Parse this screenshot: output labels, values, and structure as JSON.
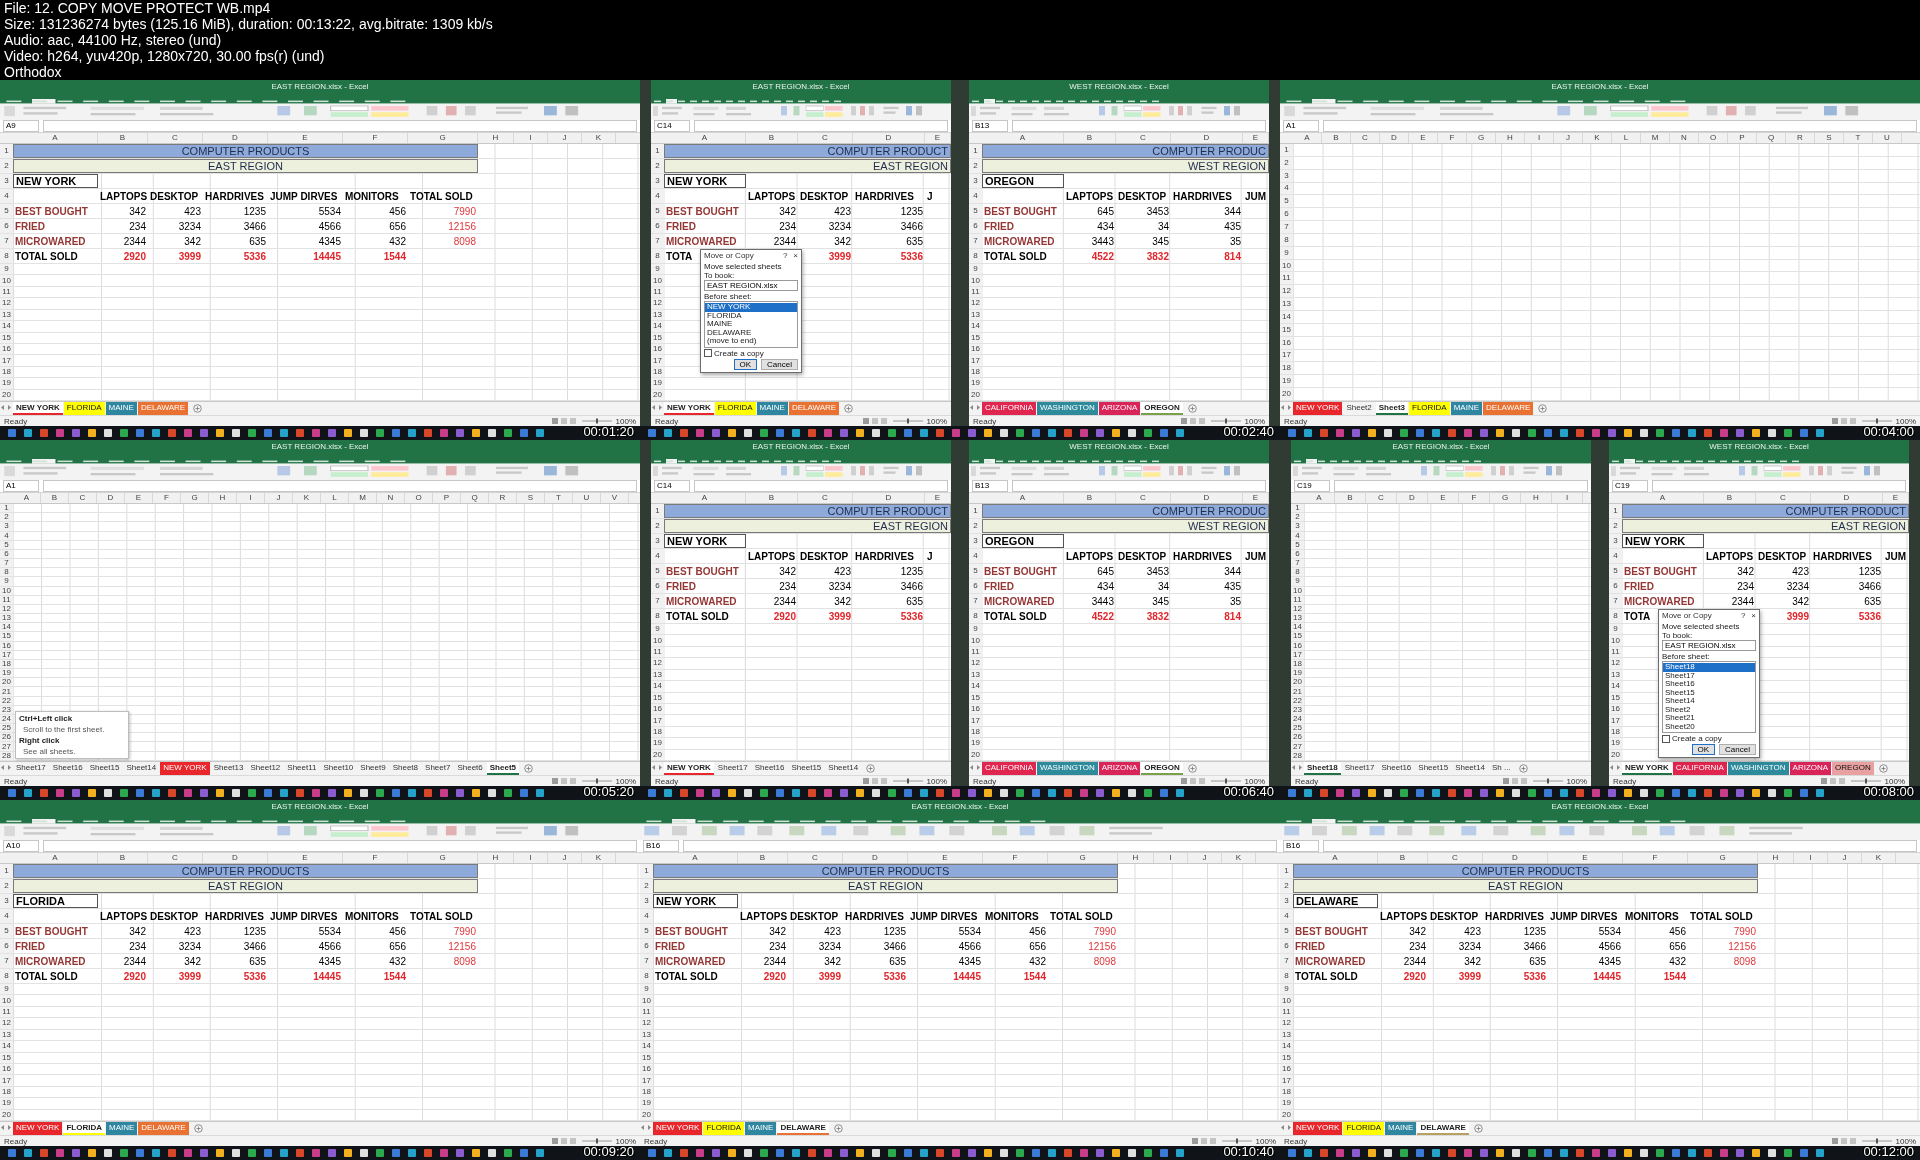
{
  "header": [
    "File: 12. COPY MOVE PROTECT WB.mp4",
    "Size: 131236274 bytes (125.16 MiB), duration: 00:13:22, avg.bitrate: 1309 kb/s",
    "Audio: aac, 44100 Hz, stereo (und)",
    "Video: h264, yuv420p, 1280x720, 30.00 fps(r) (und)",
    "Orthodox"
  ],
  "frames": [
    {
      "time": "00:01:20",
      "windows": [
        {
          "title": "EAST REGION.xlsx - Excel",
          "ribbon": {
            "kind": "home"
          },
          "name_box": "A9",
          "kind": "table",
          "columns": [
            "A",
            "B",
            "C",
            "D",
            "E",
            "F",
            "G",
            "H",
            "I",
            "J",
            "K"
          ],
          "rows": [
            {
              "n": "1",
              "kind": "title",
              "cells": [
                "COMPUTER PRODUCTS"
              ]
            },
            {
              "n": "2",
              "kind": "region",
              "cells": [
                "EAST REGION"
              ]
            },
            {
              "n": "3",
              "kind": "location",
              "cells": [
                "NEW YORK"
              ]
            },
            {
              "n": "4",
              "kind": "header",
              "cells": [
                "",
                "LAPTOPS",
                "DESKTOP",
                "HARDRIVES",
                "JUMP DIRVES",
                "MONITORS",
                "TOTAL SOLD"
              ]
            },
            {
              "n": "5",
              "kind": "data",
              "cells": [
                "BEST BOUGHT",
                "342",
                "423",
                "1235",
                "5534",
                "456",
                "7990"
              ]
            },
            {
              "n": "6",
              "kind": "data",
              "cells": [
                "FRIED",
                "234",
                "3234",
                "3466",
                "4566",
                "656",
                "12156"
              ]
            },
            {
              "n": "7",
              "kind": "data",
              "cells": [
                "MICROWARED",
                "2344",
                "342",
                "635",
                "4345",
                "432",
                "8098"
              ]
            },
            {
              "n": "8",
              "kind": "total",
              "cells": [
                "TOTAL SOLD",
                "2920",
                "3999",
                "5336",
                "14445",
                "1544"
              ]
            }
          ],
          "blank_rows": [
            "9",
            "10",
            "11",
            "12",
            "13",
            "14",
            "15",
            "16",
            "17",
            "18",
            "19",
            "20"
          ],
          "tabs": [
            {
              "label": "NEW YORK",
              "color": "#e8262b",
              "selected": true
            },
            {
              "label": "FLORIDA",
              "color": "#ffff00",
              "selected": false
            },
            {
              "label": "MAINE",
              "color": "#2e86a0",
              "selected": false
            },
            {
              "label": "DELAWARE",
              "color": "#e97132",
              "selected": false
            }
          ],
          "status": "Ready",
          "zoom": "100%"
        }
      ]
    },
    {
      "time": "00:02:40",
      "windows": [
        {
          "title": "EAST REGION.xlsx - Excel",
          "ribbon": {
            "kind": "home"
          },
          "name_box": "C14",
          "kind": "table",
          "columns": [
            "A",
            "B",
            "C",
            "D",
            "E"
          ],
          "rows": [
            {
              "n": "1",
              "kind": "title",
              "cells": [
                "COMPUTER PRODUCT"
              ]
            },
            {
              "n": "2",
              "kind": "region",
              "cells": [
                "EAST REGION"
              ]
            },
            {
              "n": "3",
              "kind": "location",
              "cells": [
                "NEW YORK"
              ]
            },
            {
              "n": "4",
              "kind": "header",
              "cells": [
                "",
                "LAPTOPS",
                "DESKTOP",
                "HARDRIVES",
                "J"
              ]
            },
            {
              "n": "5",
              "kind": "data",
              "cells": [
                "BEST BOUGHT",
                "342",
                "423",
                "1235"
              ]
            },
            {
              "n": "6",
              "kind": "data",
              "cells": [
                "FRIED",
                "234",
                "3234",
                "3466"
              ]
            },
            {
              "n": "7",
              "kind": "data",
              "cells": [
                "MICROWARED",
                "2344",
                "342",
                "635"
              ]
            },
            {
              "n": "8",
              "kind": "total",
              "cells": [
                "TOTA",
                null,
                "3999",
                "5336"
              ]
            }
          ],
          "blank_rows": [
            "9",
            "10",
            "11",
            "12",
            "13",
            "14",
            "15",
            "16",
            "17",
            "18",
            "19",
            "20"
          ],
          "tabs": [
            {
              "label": "NEW YORK",
              "color": "#e8262b",
              "selected": true
            },
            {
              "label": "FLORIDA",
              "color": "#ffff00",
              "selected": false
            },
            {
              "label": "MAINE",
              "color": "#2e86a0",
              "selected": false
            },
            {
              "label": "DELAWARE",
              "color": "#e97132",
              "selected": false
            }
          ],
          "status": "Ready",
          "zoom": "100%",
          "dialog": {
            "title": "Move or Copy",
            "help": "?",
            "close": "×",
            "caption": "Move selected sheets",
            "to_book_label": "To book:",
            "to_book": "EAST REGION.xlsx",
            "before_label": "Before sheet:",
            "items": [
              {
                "label": "NEW YORK",
                "selected": true
              },
              {
                "label": "FLORIDA",
                "selected": false
              },
              {
                "label": "MAINE",
                "selected": false
              },
              {
                "label": "DELAWARE",
                "selected": false
              },
              {
                "label": "(move to end)",
                "selected": false
              }
            ],
            "copy_label": "Create a copy",
            "copy_checked": false,
            "ok": "OK",
            "cancel": "Cancel"
          }
        },
        {
          "title": "WEST REGION.xlsx - Excel",
          "ribbon": {
            "kind": "home"
          },
          "name_box": "B13",
          "kind": "table",
          "columns": [
            "A",
            "B",
            "C",
            "D",
            "E"
          ],
          "rows": [
            {
              "n": "1",
              "kind": "title",
              "cells": [
                "COMPUTER PRODUC"
              ]
            },
            {
              "n": "2",
              "kind": "region",
              "cells": [
                "WEST REGION"
              ]
            },
            {
              "n": "3",
              "kind": "location",
              "cells": [
                "OREGON"
              ]
            },
            {
              "n": "4",
              "kind": "header",
              "cells": [
                "",
                "LAPTOPS",
                "DESKTOP",
                "HARDRIVES",
                "JUM"
              ]
            },
            {
              "n": "5",
              "kind": "data",
              "cells": [
                "BEST BOUGHT",
                "645",
                "3453",
                "344"
              ]
            },
            {
              "n": "6",
              "kind": "data",
              "cells": [
                "FRIED",
                "434",
                "34",
                "435"
              ]
            },
            {
              "n": "7",
              "kind": "data",
              "cells": [
                "MICROWARED",
                "3443",
                "345",
                "35"
              ]
            },
            {
              "n": "8",
              "kind": "total",
              "cells": [
                "TOTAL SOLD",
                "4522",
                "3832",
                "814"
              ]
            }
          ],
          "blank_rows": [
            "9",
            "10",
            "11",
            "12",
            "13",
            "14",
            "15",
            "16",
            "17",
            "18",
            "19",
            "20"
          ],
          "tabs": [
            {
              "label": "CALIFORNIA",
              "color": "#e0264f",
              "selected": false
            },
            {
              "label": "WASHINGTON",
              "color": "#2e8b9c",
              "selected": false
            },
            {
              "label": "ARIZONA",
              "color": "#d9245a",
              "selected": false
            },
            {
              "label": "OREGON",
              "color": "#7aa04a",
              "selected": true
            }
          ],
          "status": "Ready",
          "zoom": "100%"
        }
      ]
    },
    {
      "time": "00:04:00",
      "windows": [
        {
          "title": "EAST REGION.xlsx - Excel",
          "ribbon": {
            "kind": "home"
          },
          "name_box": "A1",
          "kind": "blank",
          "columns": [
            "A",
            "B",
            "C",
            "D",
            "E",
            "F",
            "G",
            "H",
            "I",
            "J",
            "K",
            "L",
            "M",
            "N",
            "O",
            "P",
            "Q",
            "R",
            "S",
            "T",
            "U"
          ],
          "blank_rows": [
            "1",
            "2",
            "3",
            "4",
            "5",
            "6",
            "7",
            "8",
            "9",
            "10",
            "11",
            "12",
            "13",
            "14",
            "15",
            "16",
            "17",
            "18",
            "19",
            "20"
          ],
          "tabs": [
            {
              "label": "NEW YORK",
              "color": "#e8262b",
              "selected": false
            },
            {
              "label": "Sheet2",
              "selected": false
            },
            {
              "label": "Sheet3",
              "selected": true
            },
            {
              "label": "FLORIDA",
              "color": "#ffff00",
              "selected": false
            },
            {
              "label": "MAINE",
              "color": "#2e86a0",
              "selected": false
            },
            {
              "label": "DELAWARE",
              "color": "#e97132",
              "selected": false
            }
          ],
          "status": "Ready",
          "zoom": "100%"
        }
      ]
    },
    {
      "time": "00:05:20",
      "windows": [
        {
          "title": "EAST REGION.xlsx - Excel",
          "ribbon": {
            "kind": "home"
          },
          "name_box": "A1",
          "kind": "blank",
          "columns": [
            "A",
            "B",
            "C",
            "D",
            "E",
            "F",
            "G",
            "H",
            "I",
            "J",
            "K",
            "L",
            "M",
            "N",
            "O",
            "P",
            "Q",
            "R",
            "S",
            "T",
            "U",
            "V"
          ],
          "blank_rows": [
            "1",
            "2",
            "3",
            "4",
            "5",
            "6",
            "7",
            "8",
            "9",
            "10",
            "11",
            "12",
            "13",
            "14",
            "15",
            "16",
            "17",
            "18",
            "19",
            "20",
            "21",
            "22",
            "23",
            "24",
            "25",
            "26",
            "27",
            "28"
          ],
          "tabs": [
            {
              "label": "Sheet17",
              "selected": false
            },
            {
              "label": "Sheet16",
              "selected": false
            },
            {
              "label": "Sheet15",
              "selected": false
            },
            {
              "label": "Sheet14",
              "selected": false
            },
            {
              "label": "NEW YORK",
              "color": "#e8262b",
              "selected": false
            },
            {
              "label": "Sheet13",
              "selected": false
            },
            {
              "label": "Sheet12",
              "selected": false
            },
            {
              "label": "Sheet11",
              "selected": false
            },
            {
              "label": "Sheet10",
              "selected": false
            },
            {
              "label": "Sheet9",
              "selected": false
            },
            {
              "label": "Sheet8",
              "selected": false
            },
            {
              "label": "Sheet7",
              "selected": false
            },
            {
              "label": "Sheet6",
              "selected": false
            },
            {
              "label": "Sheet5",
              "selected": true
            }
          ],
          "status": "Ready",
          "zoom": "100%",
          "tooltip": [
            {
              "kind": "heading",
              "text": "Ctrl+Left click"
            },
            {
              "kind": "body",
              "text": "Scroll to the first sheet."
            },
            {
              "kind": "heading",
              "text": "Right click"
            },
            {
              "kind": "body",
              "text": "See all sheets."
            }
          ]
        }
      ]
    },
    {
      "time": "00:06:40",
      "windows": [
        {
          "title": "EAST REGION.xlsx - Excel",
          "ribbon": {
            "kind": "home"
          },
          "name_box": "C14",
          "kind": "table",
          "columns": [
            "A",
            "B",
            "C",
            "D",
            "E"
          ],
          "rows": [
            {
              "n": "1",
              "kind": "title",
              "cells": [
                "COMPUTER PRODUCT"
              ]
            },
            {
              "n": "2",
              "kind": "region",
              "cells": [
                "EAST REGION"
              ]
            },
            {
              "n": "3",
              "kind": "location",
              "cells": [
                "NEW YORK"
              ]
            },
            {
              "n": "4",
              "kind": "header",
              "cells": [
                "",
                "LAPTOPS",
                "DESKTOP",
                "HARDRIVES",
                "J"
              ]
            },
            {
              "n": "5",
              "kind": "data",
              "cells": [
                "BEST BOUGHT",
                "342",
                "423",
                "1235"
              ]
            },
            {
              "n": "6",
              "kind": "data",
              "cells": [
                "FRIED",
                "234",
                "3234",
                "3466"
              ]
            },
            {
              "n": "7",
              "kind": "data",
              "cells": [
                "MICROWARED",
                "2344",
                "342",
                "635"
              ]
            },
            {
              "n": "8",
              "kind": "total",
              "cells": [
                "TOTAL SOLD",
                "2920",
                "3999",
                "5336"
              ]
            }
          ],
          "blank_rows": [
            "9",
            "10",
            "11",
            "12",
            "13",
            "14",
            "15",
            "16",
            "17",
            "18",
            "19",
            "20"
          ],
          "tabs": [
            {
              "label": "NEW YORK",
              "color": "#e8262b",
              "selected": true
            },
            {
              "label": "Sheet17",
              "selected": false
            },
            {
              "label": "Sheet16",
              "selected": false
            },
            {
              "label": "Sheet15",
              "selected": false
            },
            {
              "label": "Sheet14",
              "selected": false
            }
          ],
          "status": "Ready",
          "zoom": "100%"
        },
        {
          "title": "WEST REGION.xlsx - Excel",
          "ribbon": {
            "kind": "home"
          },
          "name_box": "B13",
          "kind": "table",
          "columns": [
            "A",
            "B",
            "C",
            "D",
            "E"
          ],
          "rows": [
            {
              "n": "1",
              "kind": "title",
              "cells": [
                "COMPUTER PRODUC"
              ]
            },
            {
              "n": "2",
              "kind": "region",
              "cells": [
                "WEST REGION"
              ]
            },
            {
              "n": "3",
              "kind": "location",
              "cells": [
                "OREGON"
              ]
            },
            {
              "n": "4",
              "kind": "header",
              "cells": [
                "",
                "LAPTOPS",
                "DESKTOP",
                "HARDRIVES",
                "JUM"
              ]
            },
            {
              "n": "5",
              "kind": "data",
              "cells": [
                "BEST BOUGHT",
                "645",
                "3453",
                "344"
              ]
            },
            {
              "n": "6",
              "kind": "data",
              "cells": [
                "FRIED",
                "434",
                "34",
                "435"
              ]
            },
            {
              "n": "7",
              "kind": "data",
              "cells": [
                "MICROWARED",
                "3443",
                "345",
                "35"
              ]
            },
            {
              "n": "8",
              "kind": "total",
              "cells": [
                "TOTAL SOLD",
                "4522",
                "3832",
                "814"
              ]
            }
          ],
          "blank_rows": [
            "9",
            "10",
            "11",
            "12",
            "13",
            "14",
            "15",
            "16",
            "17",
            "18",
            "19",
            "20"
          ],
          "tabs": [
            {
              "label": "CALIFORNIA",
              "color": "#e0264f",
              "selected": false
            },
            {
              "label": "WASHINGTON",
              "color": "#2e8b9c",
              "selected": false
            },
            {
              "label": "ARIZONA",
              "color": "#d9245a",
              "selected": false
            },
            {
              "label": "OREGON",
              "color": "#7aa04a",
              "selected": true
            }
          ],
          "status": "Ready",
          "zoom": "100%"
        }
      ]
    },
    {
      "time": "00:08:00",
      "windows": [
        {
          "title": "EAST REGION.xlsx - Excel",
          "ribbon": {
            "kind": "home"
          },
          "name_box": "C19",
          "kind": "blank",
          "columns": [
            "A",
            "B",
            "C",
            "D",
            "E",
            "F",
            "G",
            "H",
            "I"
          ],
          "blank_rows": [
            "1",
            "2",
            "3",
            "4",
            "5",
            "6",
            "7",
            "8",
            "9",
            "10",
            "11",
            "12",
            "13",
            "14",
            "15",
            "16",
            "17",
            "18",
            "19",
            "20",
            "21",
            "22",
            "23",
            "24",
            "25",
            "26",
            "27",
            "28"
          ],
          "tabs": [
            {
              "label": "Sheet18",
              "selected": true
            },
            {
              "label": "Sheet17",
              "selected": false
            },
            {
              "label": "Sheet16",
              "selected": false
            },
            {
              "label": "Sheet15",
              "selected": false
            },
            {
              "label": "Sheet14",
              "selected": false
            },
            {
              "label": "Sh ...",
              "selected": false
            }
          ],
          "status": "Ready",
          "zoom": "100%"
        },
        {
          "title": "WEST REGION.xlsx - Excel",
          "ribbon": {
            "kind": "home"
          },
          "name_box": "C19",
          "kind": "table",
          "columns": [
            "A",
            "B",
            "C",
            "D",
            "E"
          ],
          "rows": [
            {
              "n": "1",
              "kind": "title",
              "cells": [
                "COMPUTER PRODUCT"
              ]
            },
            {
              "n": "2",
              "kind": "region",
              "cells": [
                "EAST REGION"
              ]
            },
            {
              "n": "3",
              "kind": "location",
              "cells": [
                "NEW YORK"
              ]
            },
            {
              "n": "4",
              "kind": "header",
              "cells": [
                "",
                "LAPTOPS",
                "DESKTOP",
                "HARDRIVES",
                "JUM"
              ]
            },
            {
              "n": "5",
              "kind": "data",
              "cells": [
                "BEST BOUGHT",
                "342",
                "423",
                "1235"
              ]
            },
            {
              "n": "6",
              "kind": "data",
              "cells": [
                "FRIED",
                "234",
                "3234",
                "3466"
              ]
            },
            {
              "n": "7",
              "kind": "data",
              "cells": [
                "MICROWARED",
                "2344",
                "342",
                "635"
              ]
            },
            {
              "n": "8",
              "kind": "total",
              "cells": [
                "TOTA",
                null,
                "3999",
                "5336"
              ]
            }
          ],
          "blank_rows": [
            "9",
            "10",
            "11",
            "12",
            "13",
            "14",
            "15",
            "16",
            "17",
            "18",
            "19",
            "20"
          ],
          "tabs": [
            {
              "label": "NEW YORK",
              "selected": true
            },
            {
              "label": "CALIFORNIA",
              "color": "#e0264f",
              "selected": false
            },
            {
              "label": "WASHINGTON",
              "color": "#2e8b9c",
              "selected": false
            },
            {
              "label": "ARIZONA",
              "color": "#d9245a",
              "selected": false
            },
            {
              "label": "OREGON",
              "color": "#e8a0a0",
              "selected": false
            }
          ],
          "status": "Ready",
          "zoom": "100%",
          "dialog": {
            "title": "Move or Copy",
            "help": "?",
            "close": "×",
            "caption": "Move selected sheets",
            "to_book_label": "To book:",
            "to_book": "EAST REGION.xlsx",
            "before_label": "Before sheet:",
            "items": [
              {
                "label": "Sheet18",
                "selected": true
              },
              {
                "label": "Sheet17",
                "selected": false
              },
              {
                "label": "Sheet16",
                "selected": false
              },
              {
                "label": "Sheet15",
                "selected": false
              },
              {
                "label": "Sheet14",
                "selected": false
              },
              {
                "label": "Sheet2",
                "selected": false
              },
              {
                "label": "Sheet21",
                "selected": false
              },
              {
                "label": "Sheet20",
                "selected": false
              }
            ],
            "copy_label": "Create a copy",
            "copy_checked": false,
            "ok": "OK",
            "cancel": "Cancel"
          }
        }
      ]
    },
    {
      "time": "00:09:20",
      "windows": [
        {
          "title": "EAST REGION.xlsx - Excel",
          "ribbon": {
            "kind": "home"
          },
          "name_box": "A10",
          "kind": "table",
          "columns": [
            "A",
            "B",
            "C",
            "D",
            "E",
            "F",
            "G",
            "H",
            "I",
            "J",
            "K"
          ],
          "rows": [
            {
              "n": "1",
              "kind": "title",
              "cells": [
                "COMPUTER PRODUCTS"
              ]
            },
            {
              "n": "2",
              "kind": "region",
              "cells": [
                "EAST REGION"
              ]
            },
            {
              "n": "3",
              "kind": "location",
              "cells": [
                "FLORIDA"
              ]
            },
            {
              "n": "4",
              "kind": "header",
              "cells": [
                "",
                "LAPTOPS",
                "DESKTOP",
                "HARDRIVES",
                "JUMP DIRVES",
                "MONITORS",
                "TOTAL SOLD"
              ]
            },
            {
              "n": "5",
              "kind": "data",
              "cells": [
                "BEST BOUGHT",
                "342",
                "423",
                "1235",
                "5534",
                "456",
                "7990"
              ]
            },
            {
              "n": "6",
              "kind": "data",
              "cells": [
                "FRIED",
                "234",
                "3234",
                "3466",
                "4566",
                "656",
                "12156"
              ]
            },
            {
              "n": "7",
              "kind": "data",
              "cells": [
                "MICROWARED",
                "2344",
                "342",
                "635",
                "4345",
                "432",
                "8098"
              ]
            },
            {
              "n": "8",
              "kind": "total",
              "cells": [
                "TOTAL SOLD",
                "2920",
                "3999",
                "5336",
                "14445",
                "1544"
              ]
            }
          ],
          "blank_rows": [
            "9",
            "10",
            "11",
            "12",
            "13",
            "14",
            "15",
            "16",
            "17",
            "18",
            "19",
            "20"
          ],
          "tabs": [
            {
              "label": "NEW YORK",
              "color": "#e8262b",
              "selected": false
            },
            {
              "label": "FLORIDA",
              "color": "#ffff00",
              "selected": true
            },
            {
              "label": "MAINE",
              "color": "#2e86a0",
              "selected": false
            },
            {
              "label": "DELAWARE",
              "color": "#e97132",
              "selected": false
            }
          ],
          "status": "Ready",
          "zoom": "100%"
        }
      ]
    },
    {
      "time": "00:10:40",
      "windows": [
        {
          "title": "EAST REGION.xlsx - Excel",
          "ribbon": {
            "kind": "review"
          },
          "name_box": "B16",
          "kind": "table",
          "columns": [
            "A",
            "B",
            "C",
            "D",
            "E",
            "F",
            "G",
            "H",
            "I",
            "J",
            "K"
          ],
          "rows": [
            {
              "n": "1",
              "kind": "title",
              "cells": [
                "COMPUTER PRODUCTS"
              ]
            },
            {
              "n": "2",
              "kind": "region",
              "cells": [
                "EAST REGION"
              ]
            },
            {
              "n": "3",
              "kind": "location",
              "cells": [
                "NEW YORK"
              ]
            },
            {
              "n": "4",
              "kind": "header",
              "cells": [
                "",
                "LAPTOPS",
                "DESKTOP",
                "HARDRIVES",
                "JUMP DIRVES",
                "MONITORS",
                "TOTAL SOLD"
              ]
            },
            {
              "n": "5",
              "kind": "data",
              "cells": [
                "BEST BOUGHT",
                "342",
                "423",
                "1235",
                "5534",
                "456",
                "7990"
              ]
            },
            {
              "n": "6",
              "kind": "data",
              "cells": [
                "FRIED",
                "234",
                "3234",
                "3466",
                "4566",
                "656",
                "12156"
              ]
            },
            {
              "n": "7",
              "kind": "data",
              "cells": [
                "MICROWARED",
                "2344",
                "342",
                "635",
                "4345",
                "432",
                "8098"
              ]
            },
            {
              "n": "8",
              "kind": "total",
              "cells": [
                "TOTAL SOLD",
                "2920",
                "3999",
                "5336",
                "14445",
                "1544"
              ]
            }
          ],
          "blank_rows": [
            "9",
            "10",
            "11",
            "12",
            "13",
            "14",
            "15",
            "16",
            "17",
            "18",
            "19",
            "20"
          ],
          "tabs": [
            {
              "label": "NEW YORK",
              "color": "#e8262b",
              "selected": false
            },
            {
              "label": "FLORIDA",
              "color": "#ffff00",
              "selected": false
            },
            {
              "label": "MAINE",
              "color": "#2e86a0",
              "selected": false
            },
            {
              "label": "DELAWARE",
              "color": "#e97132",
              "selected": true
            }
          ],
          "status": "Ready",
          "zoom": "100%"
        }
      ]
    },
    {
      "time": "00:12:00",
      "windows": [
        {
          "title": "EAST REGION.xlsx - Excel",
          "ribbon": {
            "kind": "review"
          },
          "name_box": "B16",
          "kind": "table",
          "columns": [
            "A",
            "B",
            "C",
            "D",
            "E",
            "F",
            "G",
            "H",
            "I",
            "J",
            "K"
          ],
          "rows": [
            {
              "n": "1",
              "kind": "title",
              "cells": [
                "COMPUTER PRODUCTS"
              ]
            },
            {
              "n": "2",
              "kind": "region",
              "cells": [
                "EAST REGION"
              ]
            },
            {
              "n": "3",
              "kind": "location",
              "cells": [
                "DELAWARE"
              ]
            },
            {
              "n": "4",
              "kind": "header",
              "cells": [
                "",
                "LAPTOPS",
                "DESKTOP",
                "HARDRIVES",
                "JUMP DIRVES",
                "MONITORS",
                "TOTAL SOLD"
              ]
            },
            {
              "n": "5",
              "kind": "data",
              "cells": [
                "BEST BOUGHT",
                "342",
                "423",
                "1235",
                "5534",
                "456",
                "7990"
              ]
            },
            {
              "n": "6",
              "kind": "data",
              "cells": [
                "FRIED",
                "234",
                "3234",
                "3466",
                "4566",
                "656",
                "12156"
              ]
            },
            {
              "n": "7",
              "kind": "data",
              "cells": [
                "MICROWARED",
                "2344",
                "342",
                "635",
                "4345",
                "432",
                "8098"
              ]
            },
            {
              "n": "8",
              "kind": "total",
              "cells": [
                "TOTAL SOLD",
                "2920",
                "3999",
                "5336",
                "14445",
                "1544"
              ]
            }
          ],
          "blank_rows": [
            "9",
            "10",
            "11",
            "12",
            "13",
            "14",
            "15",
            "16",
            "17",
            "18",
            "19",
            "20"
          ],
          "tabs": [
            {
              "label": "NEW YORK",
              "color": "#e8262b",
              "selected": false
            },
            {
              "label": "FLORIDA",
              "color": "#ffff00",
              "selected": false
            },
            {
              "label": "MAINE",
              "color": "#2e86a0",
              "selected": false
            },
            {
              "label": "DELAWARE",
              "color": "#b8a060",
              "selected": true
            }
          ],
          "status": "Ready",
          "zoom": "100%"
        }
      ]
    }
  ]
}
